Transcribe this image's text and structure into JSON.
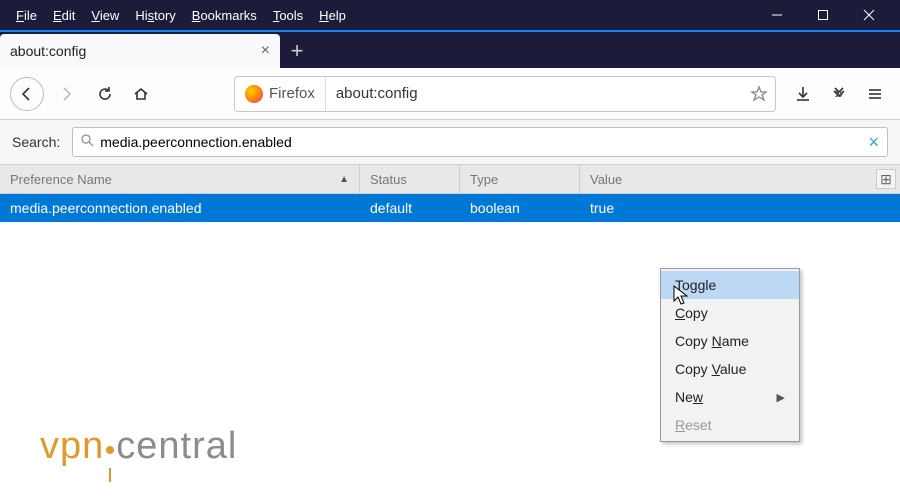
{
  "menubar": {
    "file": "File",
    "edit": "Edit",
    "view": "View",
    "history": "History",
    "bookmarks": "Bookmarks",
    "tools": "Tools",
    "help": "Help"
  },
  "tabs": {
    "active_title": "about:config"
  },
  "toolbar": {
    "identity_label": "Firefox",
    "url": "about:config"
  },
  "search": {
    "label": "Search:",
    "value": "media.peerconnection.enabled"
  },
  "columns": {
    "name": "Preference Name",
    "status": "Status",
    "type": "Type",
    "value": "Value"
  },
  "rows": [
    {
      "name": "media.peerconnection.enabled",
      "status": "default",
      "type": "boolean",
      "value": "true"
    }
  ],
  "context_menu": {
    "toggle": "Toggle",
    "copy": "Copy",
    "copy_name": "Copy Name",
    "copy_value": "Copy Value",
    "new": "New",
    "reset": "Reset"
  },
  "watermark": {
    "left": "vpn",
    "right": "central"
  }
}
